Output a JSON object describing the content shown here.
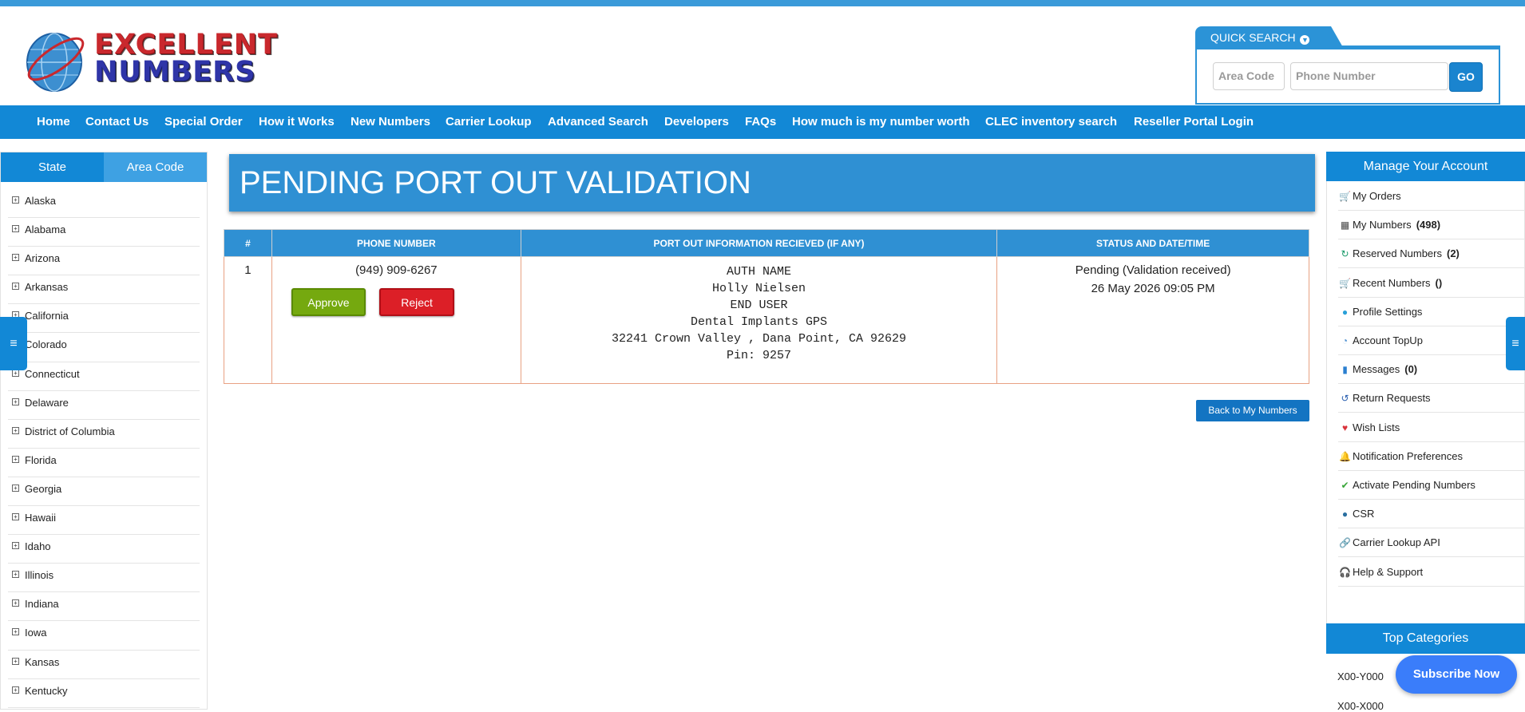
{
  "logo": {
    "line1": "EXCELLENT",
    "line2": "NUMBERS"
  },
  "quick_search": {
    "title": "QUICK SEARCH",
    "area_code_placeholder": "Area Code",
    "phone_placeholder": "Phone Number",
    "go_label": "GO"
  },
  "nav": [
    "Home",
    "Contact Us",
    "Special Order",
    "How it Works",
    "New Numbers",
    "Carrier Lookup",
    "Advanced Search",
    "Developers",
    "FAQs",
    "How much is my number worth",
    "CLEC inventory search",
    "Reseller Portal Login"
  ],
  "sidebar": {
    "tabs": [
      "State",
      "Area Code"
    ],
    "states": [
      "Alaska",
      "Alabama",
      "Arizona",
      "Arkansas",
      "California",
      "Colorado",
      "Connecticut",
      "Delaware",
      "District of Columbia",
      "Florida",
      "Georgia",
      "Hawaii",
      "Idaho",
      "Illinois",
      "Indiana",
      "Iowa",
      "Kansas",
      "Kentucky"
    ]
  },
  "main": {
    "title": "PENDING PORT OUT VALIDATION",
    "table": {
      "headers": [
        "#",
        "PHONE NUMBER",
        "PORT OUT INFORMATION RECIEVED (IF ANY)",
        "STATUS AND DATE/TIME"
      ],
      "rows": [
        {
          "index": "1",
          "phone": "(949) 909-6267",
          "approve_label": "Approve",
          "reject_label": "Reject",
          "port_info": [
            "AUTH NAME",
            "Holly Nielsen",
            "END USER",
            "Dental Implants GPS",
            "32241 Crown Valley , Dana Point, CA 92629",
            "Pin: 9257"
          ],
          "status": "Pending (Validation received)",
          "datetime": "26 May 2026 09:05 PM"
        }
      ]
    },
    "back_label": "Back to My Numbers"
  },
  "account": {
    "title": "Manage Your Account",
    "items": [
      {
        "label": "My Orders",
        "count": "",
        "icon": "cart-icon"
      },
      {
        "label": "My Numbers",
        "count": "(498)",
        "icon": "grid-icon"
      },
      {
        "label": "Reserved Numbers",
        "count": "(2)",
        "icon": "refresh-icon"
      },
      {
        "label": "Recent Numbers",
        "count": "()",
        "icon": "cart-icon"
      },
      {
        "label": "Profile Settings",
        "count": "",
        "icon": "user-icon"
      },
      {
        "label": "Account TopUp",
        "count": "",
        "icon": "topup-icon"
      },
      {
        "label": "Messages",
        "count": "(0)",
        "icon": "message-icon"
      },
      {
        "label": "Return Requests",
        "count": "",
        "icon": "return-icon"
      },
      {
        "label": "Wish Lists",
        "count": "",
        "icon": "heart-icon"
      },
      {
        "label": "Notification Preferences",
        "count": "",
        "icon": "bell-icon"
      },
      {
        "label": "Activate Pending Numbers",
        "count": "",
        "icon": "check-icon"
      },
      {
        "label": "CSR",
        "count": "",
        "icon": "csr-icon"
      },
      {
        "label": "Carrier Lookup API",
        "count": "",
        "icon": "link-icon"
      },
      {
        "label": "Help & Support",
        "count": "",
        "icon": "headphones-icon"
      }
    ]
  },
  "categories": {
    "title": "Top Categories",
    "items": [
      "X00-Y000",
      "X00-X000"
    ]
  },
  "subscribe_label": "Subscribe Now",
  "colors": {
    "brand_blue": "#1288d6",
    "approve": "#75a90f",
    "reject": "#dc1f27"
  }
}
